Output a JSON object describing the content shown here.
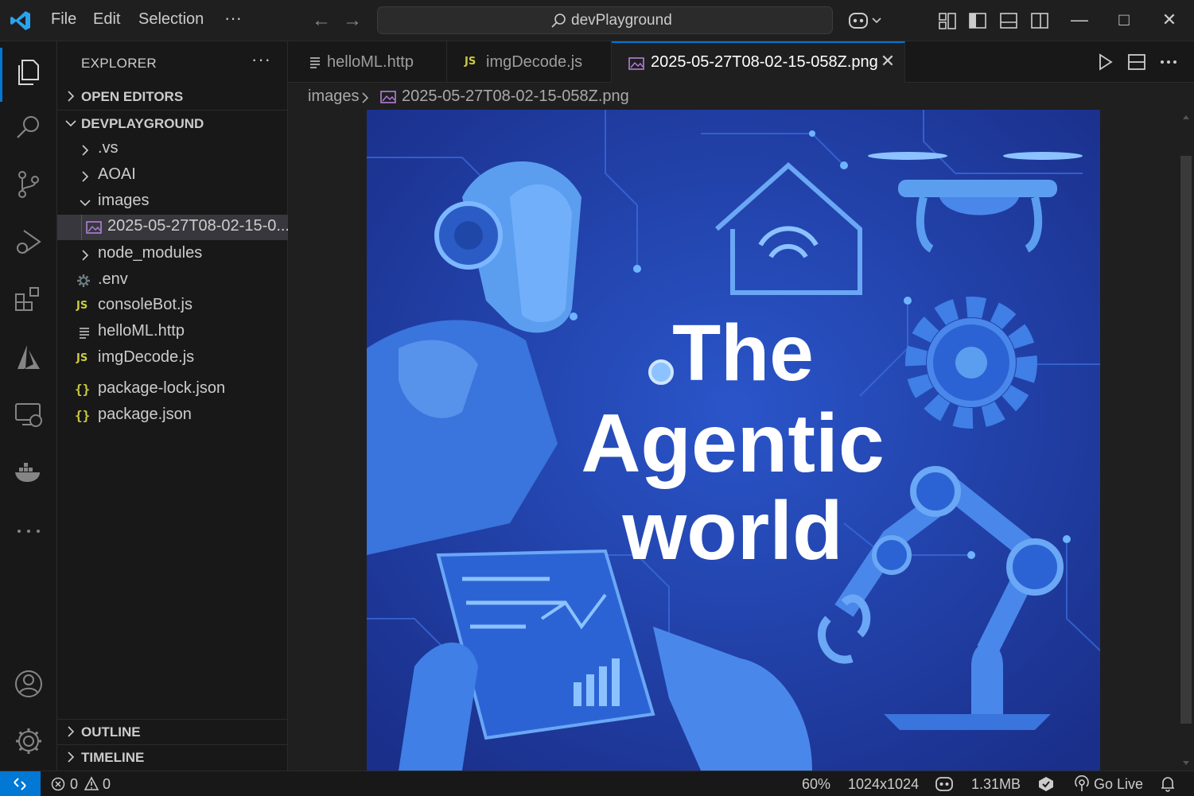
{
  "titlebar": {
    "menu": [
      "File",
      "Edit",
      "Selection"
    ],
    "more": "···",
    "search_text": "devPlayground"
  },
  "sidebar": {
    "title": "EXPLORER",
    "more": "···",
    "sections": {
      "open_editors": "OPEN EDITORS",
      "project": "DEVPLAYGROUND",
      "outline": "OUTLINE",
      "timeline": "TIMELINE"
    },
    "tree": [
      {
        "label": ".vs",
        "kind": "folder",
        "expanded": false,
        "icon": "chevron-right-icon"
      },
      {
        "label": "AOAI",
        "kind": "folder",
        "expanded": false,
        "icon": "chevron-right-icon"
      },
      {
        "label": "images",
        "kind": "folder",
        "expanded": true,
        "icon": "chevron-down-icon"
      },
      {
        "label": "2025-05-27T08-02-15-0...",
        "kind": "image-file",
        "selected": true,
        "icon": "image-file-icon"
      },
      {
        "label": "node_modules",
        "kind": "folder",
        "expanded": false,
        "icon": "chevron-right-icon"
      },
      {
        "label": ".env",
        "kind": "env-file",
        "icon": "gear-file-icon"
      },
      {
        "label": "consoleBot.js",
        "kind": "js-file",
        "icon": "js-file-icon",
        "badge": "JS"
      },
      {
        "label": "helloML.http",
        "kind": "http-file",
        "icon": "lines-file-icon"
      },
      {
        "label": "imgDecode.js",
        "kind": "js-file",
        "icon": "js-file-icon",
        "badge": "JS"
      },
      {
        "label": "package-lock.json",
        "kind": "json-file",
        "icon": "braces-file-icon",
        "badge": "{}"
      },
      {
        "label": "package.json",
        "kind": "json-file",
        "icon": "braces-file-icon",
        "badge": "{}"
      }
    ]
  },
  "tabs": [
    {
      "label": "helloML.http",
      "icon": "lines-file-icon",
      "active": false
    },
    {
      "label": "imgDecode.js",
      "icon": "js-file-icon",
      "badge": "JS",
      "active": false
    },
    {
      "label": "2025-05-27T08-02-15-058Z.png",
      "icon": "image-file-icon",
      "active": true,
      "close": "✕"
    }
  ],
  "breadcrumb": {
    "folder": "images",
    "file": "2025-05-27T08-02-15-058Z.png"
  },
  "image": {
    "title_lines": [
      "The",
      "Agentic",
      "world"
    ]
  },
  "statusbar": {
    "errors": "0",
    "warnings": "0",
    "zoom": "60%",
    "dimensions": "1024x1024",
    "filesize": "1.31MB",
    "go_live": "Go Live"
  },
  "colors": {
    "accent": "#0078d4",
    "background": "#1f1f1f",
    "sidebar": "#181818",
    "image_bg": "#1e3a9e"
  }
}
